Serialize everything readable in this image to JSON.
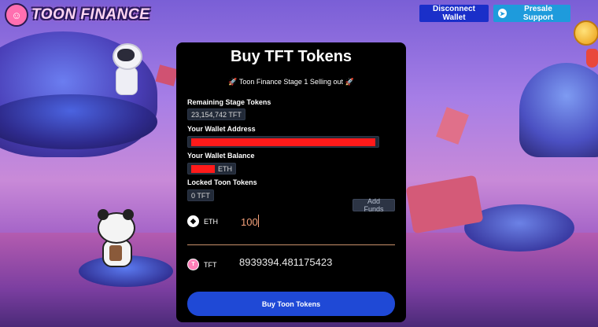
{
  "header": {
    "logo_text": "TOON FINANCE",
    "logo_icon": "toon-face-icon",
    "disconnect_label": "Disconnect Wallet",
    "presale_label": "Presale Support",
    "presale_icon": "telegram-icon"
  },
  "panel": {
    "title": "Buy TFT Tokens",
    "stage_note": "🚀 Toon Finance Stage 1 Selling out 🚀",
    "remaining_label": "Remaining Stage Tokens",
    "remaining_value": "23,154,742 TFT",
    "wallet_address_label": "Your Wallet Address",
    "wallet_address_value": "",
    "wallet_balance_label": "Your Wallet Balance",
    "wallet_balance_unit": "ETH",
    "locked_label": "Locked Toon Tokens",
    "locked_value": "0 TFT",
    "add_funds_label": "Add Funds",
    "eth_label": "ETH",
    "eth_amount": "100",
    "tft_label": "TFT",
    "tft_amount": "8939394.481175423",
    "buy_label": "Buy Toon Tokens"
  },
  "colors": {
    "panel_bg": "#000000",
    "buy_button": "#1f49d6",
    "disconnect_button": "#1a2fc9",
    "presale_button": "#1e9bdc",
    "redaction": "#ff1a1a",
    "input_text": "#f4a07a"
  }
}
